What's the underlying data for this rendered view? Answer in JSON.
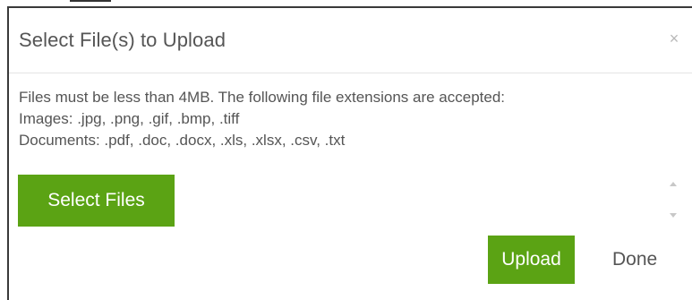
{
  "dialog": {
    "title": "Select File(s) to Upload",
    "close_glyph": "×",
    "close_icon": "close-icon"
  },
  "body": {
    "info_lines": [
      "Files must be less than 4MB. The following file extensions are accepted:",
      "Images: .jpg, .png, .gif, .bmp, .tiff",
      "Documents: .pdf, .doc, .docx, .xls, .xlsx, .csv, .txt"
    ],
    "select_files_label": "Select Files"
  },
  "footer": {
    "upload_label": "Upload",
    "done_label": "Done"
  },
  "colors": {
    "accent": "#5ba314",
    "text": "#555555",
    "close": "#b8b8b8"
  }
}
